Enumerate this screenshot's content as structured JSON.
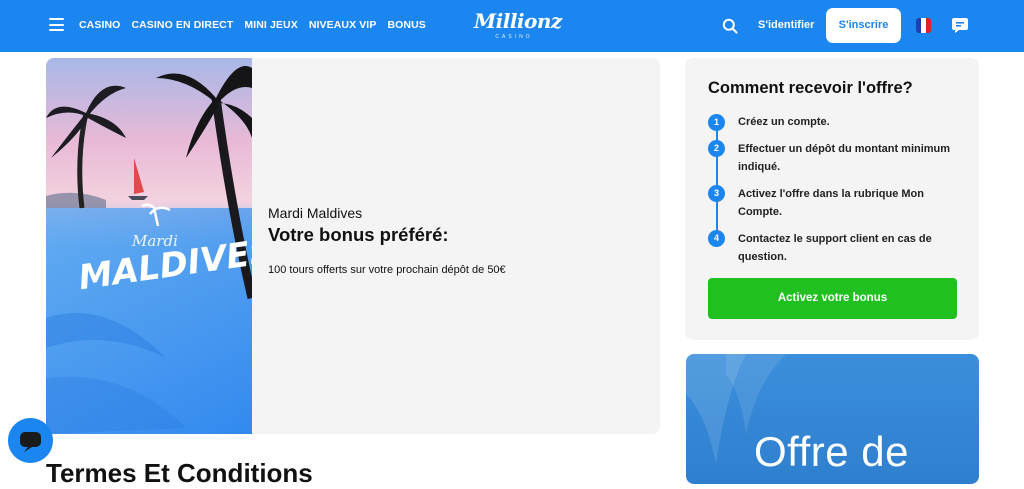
{
  "header": {
    "nav": [
      "CASINO",
      "CASINO EN DIRECT",
      "MINI JEUX",
      "NIVEAUX VIP",
      "BONUS"
    ],
    "logo_text": "Millionz",
    "logo_sub": "CASINO",
    "login_label": "S'identifier",
    "signup_label": "S'inscrire",
    "brand_color": "#1b86f0"
  },
  "promo": {
    "image_title_small": "Mardi",
    "image_title_big": "MALDIVES",
    "kicker": "Mardi Maldives",
    "title": "Votre bonus préféré:",
    "description": "100 tours offerts sur votre prochain dépôt de 50€"
  },
  "how": {
    "title": "Comment recevoir l'offre?",
    "steps": [
      {
        "num": "1",
        "text": "Créez un compte."
      },
      {
        "num": "2",
        "text": "Effectuer un dépôt du montant minimum indiqué."
      },
      {
        "num": "3",
        "text": "Activez l'offre dans la rubrique Mon Compte."
      },
      {
        "num": "4",
        "text": "Contactez le support client en cas de question."
      }
    ],
    "cta_label": "Activez votre bonus",
    "cta_color": "#1fc01f"
  },
  "banner2": {
    "text": "Offre de"
  },
  "terms_heading": "Termes Et Conditions"
}
